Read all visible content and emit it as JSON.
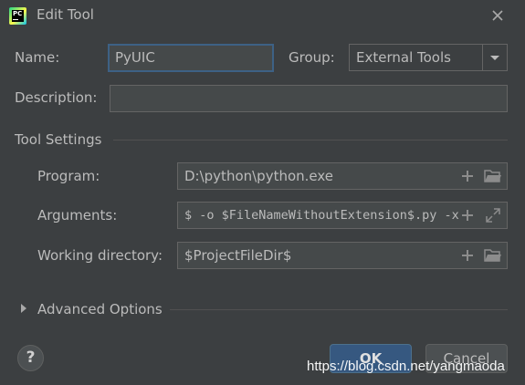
{
  "dialog": {
    "title": "Edit Tool",
    "app_icon_text": "PC"
  },
  "name_field": {
    "label": "Name:",
    "value": "PyUIC"
  },
  "group": {
    "label": "Group:",
    "selected": "External Tools"
  },
  "description": {
    "label": "Description:",
    "value": ""
  },
  "tool_settings": {
    "heading": "Tool Settings",
    "program": {
      "label": "Program:",
      "value": "D:\\python\\python.exe"
    },
    "arguments": {
      "label": "Arguments:",
      "value": "$ -o $FileNameWithoutExtension$.py -x"
    },
    "working_directory": {
      "label": "Working directory:",
      "value": "$ProjectFileDir$"
    }
  },
  "advanced_options": {
    "label": "Advanced Options"
  },
  "buttons": {
    "help": "?",
    "ok": "OK",
    "cancel": "Cancel"
  },
  "watermark": "https://blog.csdn.net/yangmaoda",
  "colors": {
    "background": "#3c3f41",
    "field_background": "#45494a",
    "focus_border": "#3d6185",
    "ok_button": "#365880",
    "icon_gray": "#8c8c8c"
  }
}
